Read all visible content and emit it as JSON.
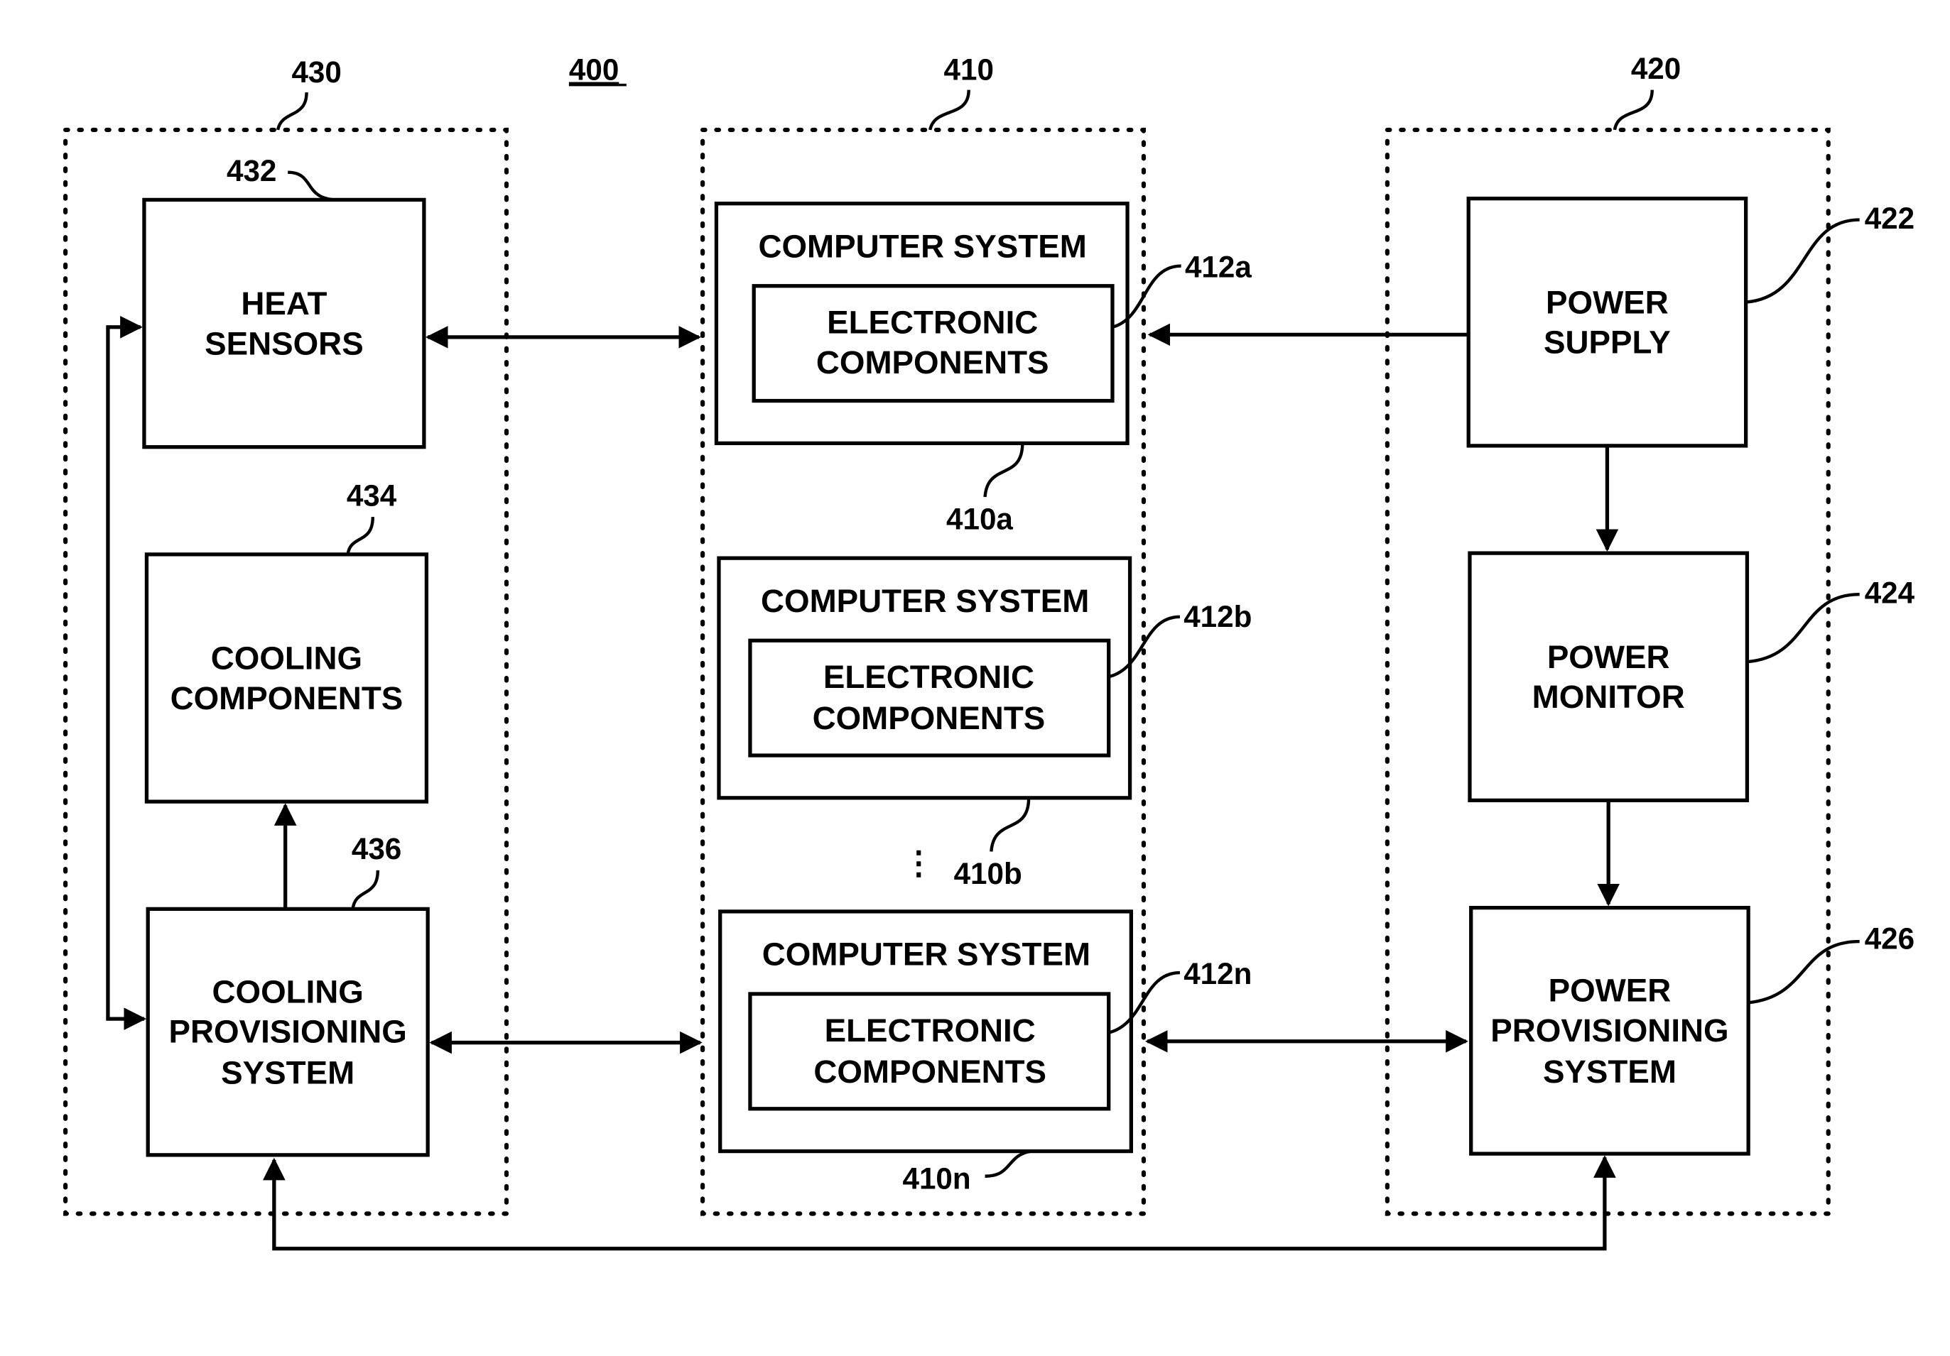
{
  "figure": {
    "figure_number": "400",
    "colors": {
      "stroke": "#000000",
      "background": "#ffffff"
    }
  },
  "groups": {
    "cooling": {
      "ref": "430"
    },
    "computers": {
      "ref": "410"
    },
    "power": {
      "ref": "420"
    }
  },
  "blocks": {
    "heat_sensors": {
      "ref": "432",
      "lines": [
        "HEAT",
        "SENSORS"
      ]
    },
    "cooling_components": {
      "ref": "434",
      "lines": [
        "COOLING",
        "COMPONENTS"
      ]
    },
    "cooling_provisioning": {
      "ref": "436",
      "lines": [
        "COOLING",
        "PROVISIONING",
        "SYSTEM"
      ]
    },
    "power_supply": {
      "ref": "422",
      "lines": [
        "POWER",
        "SUPPLY"
      ]
    },
    "power_monitor": {
      "ref": "424",
      "lines": [
        "POWER",
        "MONITOR"
      ]
    },
    "power_provisioning": {
      "ref": "426",
      "lines": [
        "POWER",
        "PROVISIONING",
        "SYSTEM"
      ]
    }
  },
  "computer_systems": [
    {
      "ref": "410a",
      "title": "COMPUTER SYSTEM",
      "inner_ref": "412a",
      "inner_lines": [
        "ELECTRONIC",
        "COMPONENTS"
      ]
    },
    {
      "ref": "410b",
      "title": "COMPUTER SYSTEM",
      "inner_ref": "412b",
      "inner_lines": [
        "ELECTRONIC",
        "COMPONENTS"
      ]
    },
    {
      "ref": "410n",
      "title": "COMPUTER SYSTEM",
      "inner_ref": "412n",
      "inner_lines": [
        "ELECTRONIC",
        "COMPONENTS"
      ]
    }
  ],
  "ellipsis": "⋮"
}
